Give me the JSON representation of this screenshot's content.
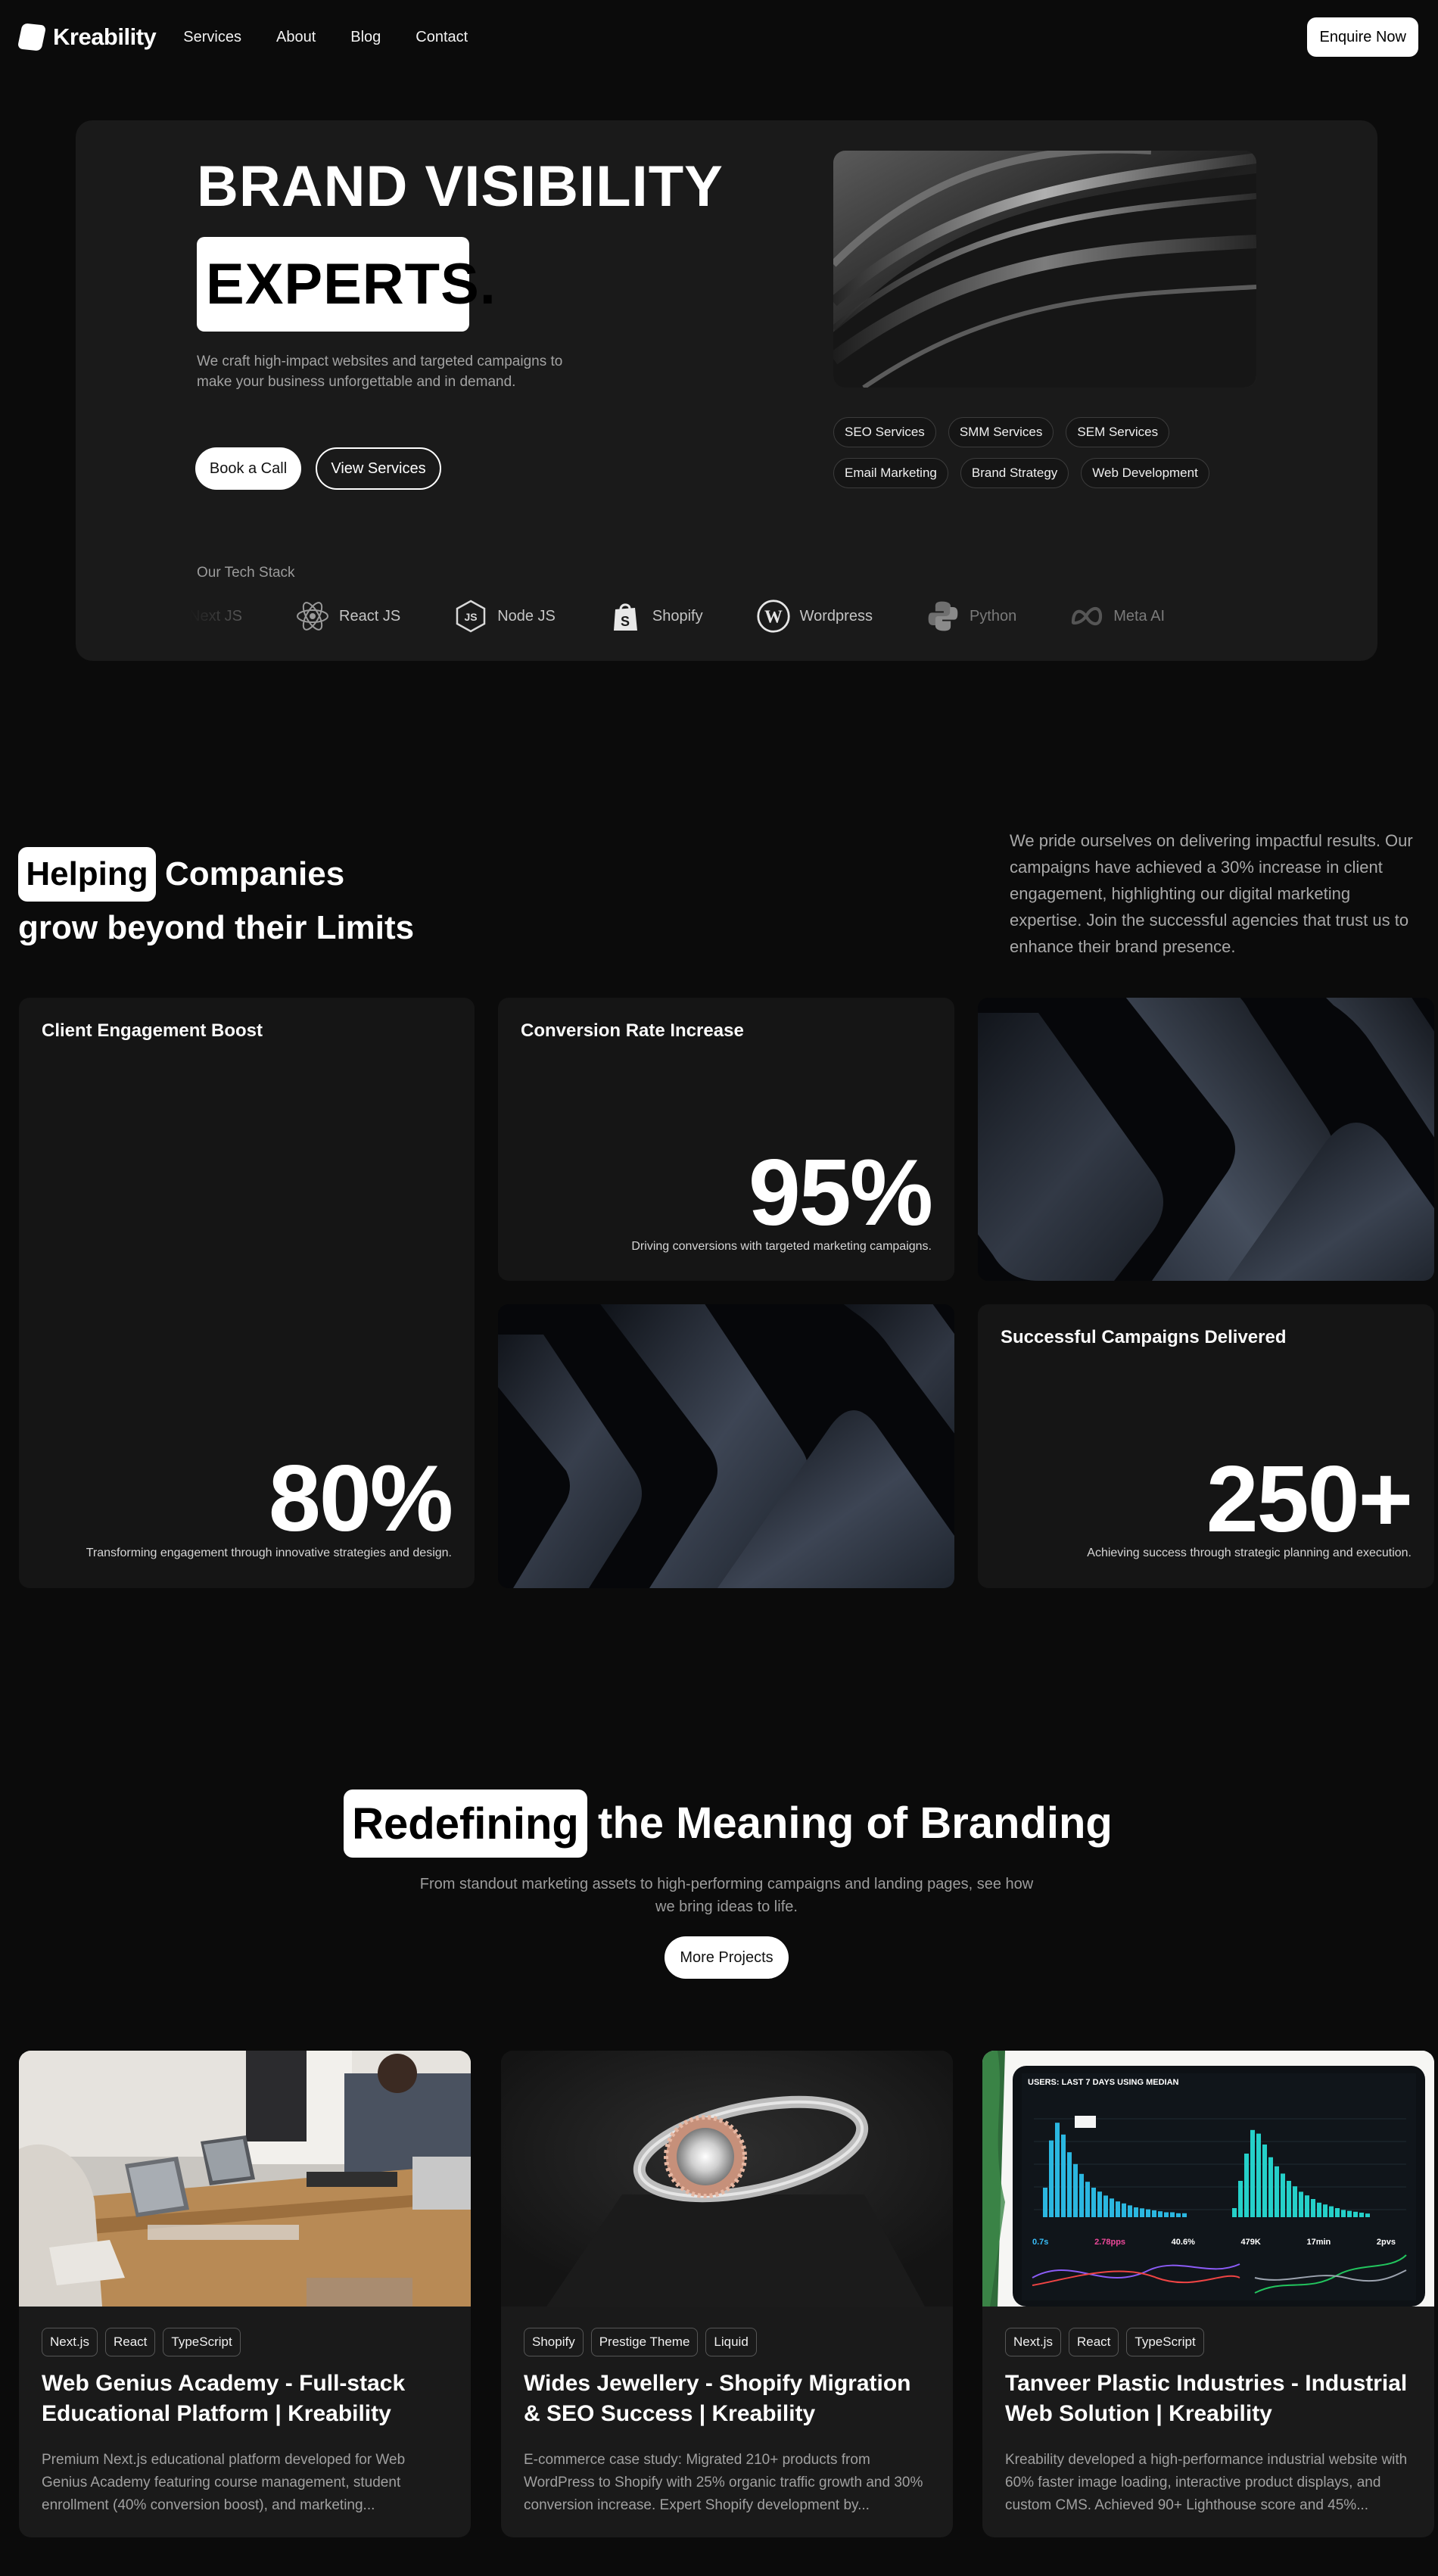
{
  "nav": {
    "brand": "Kreability",
    "links": [
      "Services",
      "About",
      "Blog",
      "Contact"
    ],
    "cta": "Enquire Now"
  },
  "hero": {
    "title_line1": "BRAND VISIBILITY",
    "title_line2": "EXPERTS.",
    "description": "We craft high-impact websites and targeted campaigns to make your business unforgettable and in demand.",
    "primary_button": "Book a Call",
    "secondary_button": "View Services",
    "services": [
      "SEO Services",
      "SMM Services",
      "SEM Services",
      "Email Marketing",
      "Brand Strategy",
      "Web Development"
    ],
    "tech_stack_label": "Our Tech Stack",
    "tech_stack": [
      {
        "label": "Next JS",
        "icon": "nextjs-icon"
      },
      {
        "label": "React JS",
        "icon": "react-icon"
      },
      {
        "label": "Node JS",
        "icon": "nodejs-icon"
      },
      {
        "label": "Shopify",
        "icon": "shopify-icon"
      },
      {
        "label": "Wordpress",
        "icon": "wordpress-icon"
      },
      {
        "label": "Python",
        "icon": "python-icon"
      },
      {
        "label": "Meta AI",
        "icon": "meta-icon"
      }
    ]
  },
  "stats_section": {
    "highlight": "Helping",
    "title_rest": "Companies",
    "title_line2": "grow beyond their Limits",
    "description": "We pride ourselves on delivering impactful results. Our campaigns have achieved a 30% increase in client engagement, highlighting our digital marketing expertise. Join the successful agencies that trust us to enhance their brand presence.",
    "cards": [
      {
        "title": "Client Engagement Boost",
        "value": "80%",
        "subtitle": "Transforming engagement through innovative strategies and design."
      },
      {
        "title": "Conversion Rate Increase",
        "value": "95%",
        "subtitle": "Driving conversions with targeted marketing campaigns."
      },
      {
        "title": "Successful Campaigns Delivered",
        "value": "250+",
        "subtitle": "Achieving success through strategic planning and execution."
      }
    ]
  },
  "projects_section": {
    "highlight": "Redefining",
    "title_rest": "the Meaning of Branding",
    "description": "From standout marketing assets to high-performing campaigns and landing pages, see how we bring ideas to life.",
    "button": "More Projects",
    "projects": [
      {
        "tags": [
          "Next.js",
          "React",
          "TypeScript"
        ],
        "title": "Web Genius Academy - Full-stack Educational Platform | Kreability",
        "description": "Premium Next.js educational platform developed for Web Genius Academy featuring course management, student enrollment (40% conversion boost), and marketing..."
      },
      {
        "tags": [
          "Shopify",
          "Prestige Theme",
          "Liquid"
        ],
        "title": "Wides Jewellery - Shopify Migration & SEO Success | Kreability",
        "description": "E-commerce case study: Migrated 210+ products from WordPress to Shopify with 25% organic traffic growth and 30% conversion increase. Expert Shopify development by..."
      },
      {
        "tags": [
          "Next.js",
          "React",
          "TypeScript"
        ],
        "title": "Tanveer Plastic Industries - Industrial Web Solution | Kreability",
        "description": "Kreability developed a high-performance industrial website with 60% faster image loading, interactive product displays, and custom CMS. Achieved 90+ Lighthouse score and 45%..."
      }
    ],
    "dashboard": {
      "header": "USERS: LAST 7 DAYS USING MEDIAN",
      "metrics": [
        "0.7s",
        "2.78pps",
        "40.6%",
        "479K",
        "17min",
        "2pvs"
      ]
    }
  },
  "colors": {
    "background": "#0b0b0b",
    "hero_card": "#1a1a1a",
    "stat_card": "#151515",
    "accent_white": "#ffffff",
    "muted_text": "#a3a3a3"
  }
}
